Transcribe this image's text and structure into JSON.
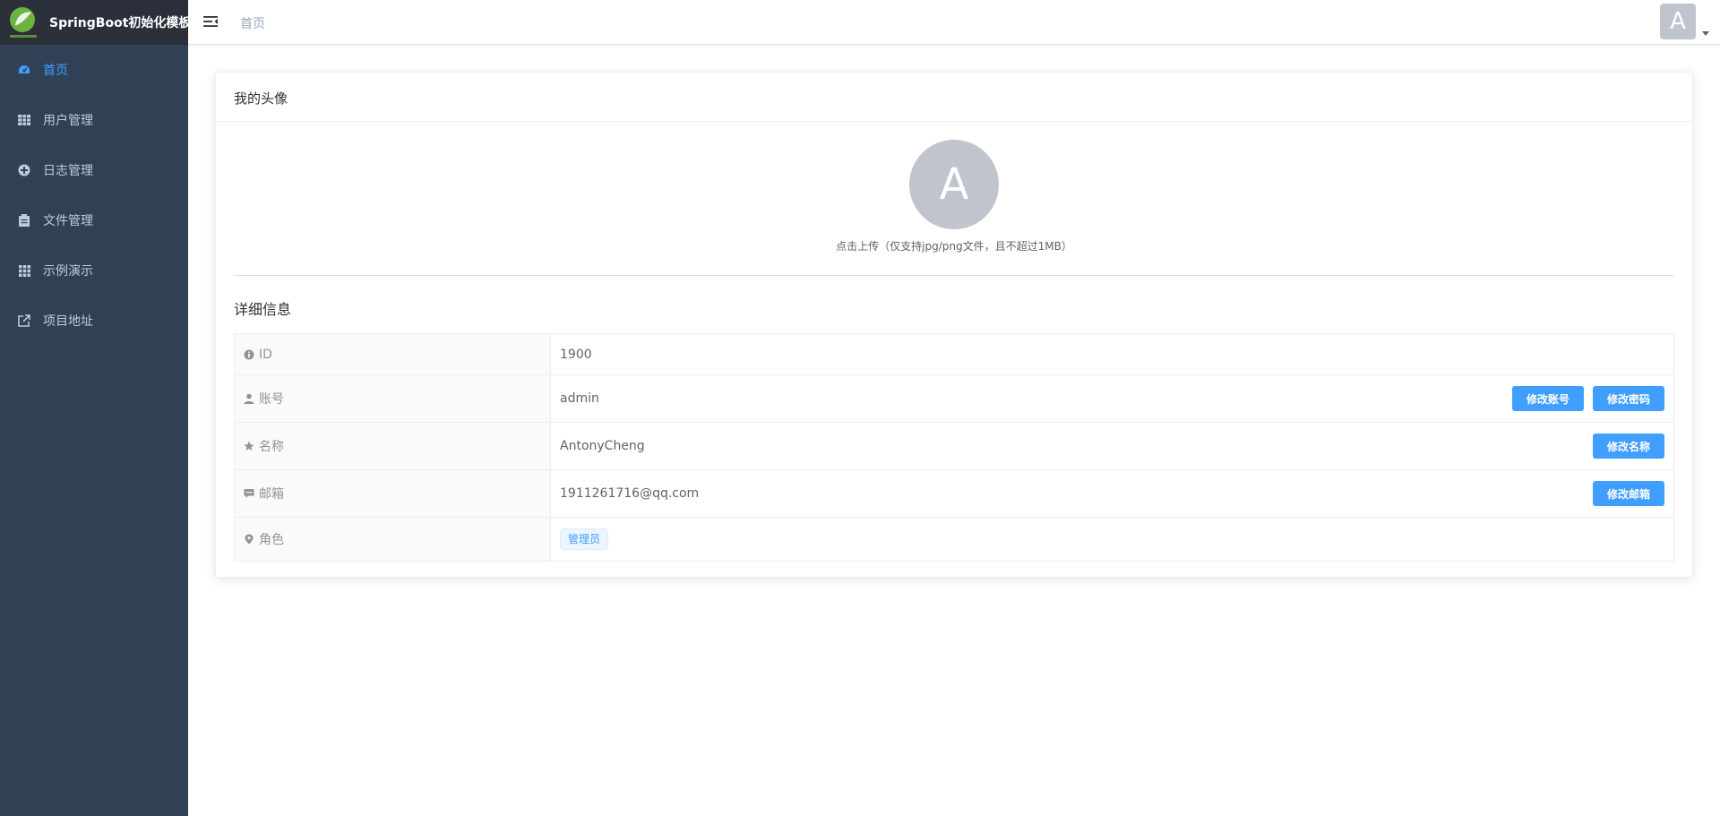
{
  "app": {
    "title": "SpringBoot初始化模板"
  },
  "sidebar": {
    "items": [
      {
        "label": "首页",
        "icon": "dashboard-icon",
        "active": true
      },
      {
        "label": "用户管理",
        "icon": "table-icon",
        "active": false
      },
      {
        "label": "日志管理",
        "icon": "log-icon",
        "active": false
      },
      {
        "label": "文件管理",
        "icon": "clipboard-icon",
        "active": false
      },
      {
        "label": "示例演示",
        "icon": "grid-icon",
        "active": false
      },
      {
        "label": "项目地址",
        "icon": "external-link-icon",
        "active": false
      }
    ]
  },
  "header": {
    "breadcrumb": "首页",
    "avatar_letter": "A"
  },
  "card": {
    "title": "我的头像",
    "avatar_letter": "A",
    "upload_hint": "点击上传（仅支持jpg/png文件，且不超过1MB）",
    "detail_title": "详细信息"
  },
  "details": {
    "id": {
      "label": "ID",
      "value": "1900"
    },
    "account": {
      "label": "账号",
      "value": "admin",
      "btn1": "修改账号",
      "btn2": "修改密码"
    },
    "name": {
      "label": "名称",
      "value": "AntonyCheng",
      "btn": "修改名称"
    },
    "email": {
      "label": "邮箱",
      "value": "1911261716@qq.com",
      "btn": "修改邮箱"
    },
    "role": {
      "label": "角色",
      "value": "管理员"
    }
  },
  "colors": {
    "sidebar_bg": "#304156",
    "accent": "#409eff",
    "logo_bar": "#2b2f3a"
  }
}
